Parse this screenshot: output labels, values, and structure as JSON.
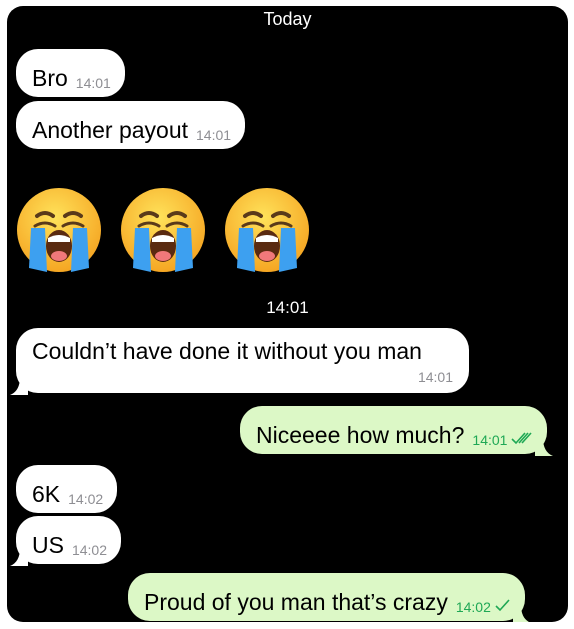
{
  "chat": {
    "date_separator": "Today",
    "time_separator": "14:01",
    "messages": [
      {
        "text": "Bro",
        "time": "14:01"
      },
      {
        "text": "Another payout",
        "time": "14:01"
      },
      {
        "text": "Couldn’t have done it without you man",
        "time": "14:01"
      },
      {
        "text": "Niceeee how much?",
        "time": "14:01"
      },
      {
        "text": "6K",
        "time": "14:02"
      },
      {
        "text": "US",
        "time": "14:02"
      },
      {
        "text": "Proud of you man that’s crazy",
        "time": "14:02"
      }
    ],
    "emojis": [
      "loudly-crying-face",
      "loudly-crying-face",
      "loudly-crying-face"
    ],
    "colors": {
      "background": "#000000",
      "incoming_bubble": "#ffffff",
      "outgoing_bubble": "#dcf8c6",
      "outgoing_time": "#1fa855",
      "incoming_time": "#8e8e93"
    },
    "status_icons": [
      "double-check-read-icon",
      "single-check-sent-icon"
    ]
  }
}
